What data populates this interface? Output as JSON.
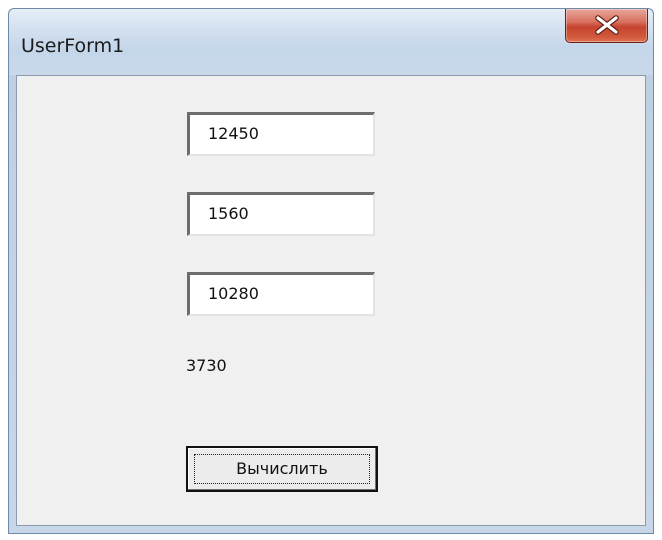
{
  "window": {
    "title": "UserForm1"
  },
  "form": {
    "textbox1_value": "12450",
    "textbox2_value": "1560",
    "textbox3_value": "10280",
    "result_label": "3730",
    "calculate_button_label": "Вычислить"
  },
  "colors": {
    "close_button": "#c5432f",
    "client_background": "#f0f0f0",
    "titlebar": "#c9d9ea"
  },
  "icons": {
    "close": "close-icon"
  }
}
